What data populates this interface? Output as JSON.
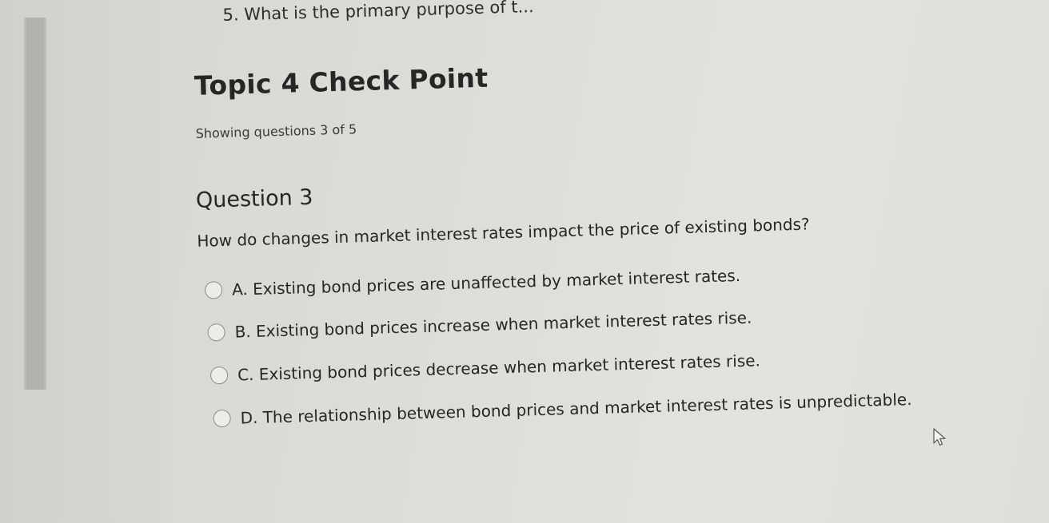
{
  "prev_question": "5. What is the primary purpose of t...",
  "topic_title": "Topic 4 Check Point",
  "progress_text": "Showing questions 3 of 5",
  "question": {
    "heading": "Question 3",
    "text": "How do changes in market interest rates impact the price of existing bonds?",
    "options": [
      {
        "label": "A. Existing bond prices are unaffected by market interest rates.",
        "selected": false
      },
      {
        "label": "B. Existing bond prices increase when market interest rates rise.",
        "selected": false
      },
      {
        "label": "C. Existing bond prices decrease when market interest rates rise.",
        "selected": false
      },
      {
        "label": "D. The relationship between bond prices and market interest rates is unpredictable.",
        "selected": false
      }
    ]
  },
  "icons": {
    "cursor": "mouse-pointer-icon",
    "radio": "radio-button-unselected"
  }
}
